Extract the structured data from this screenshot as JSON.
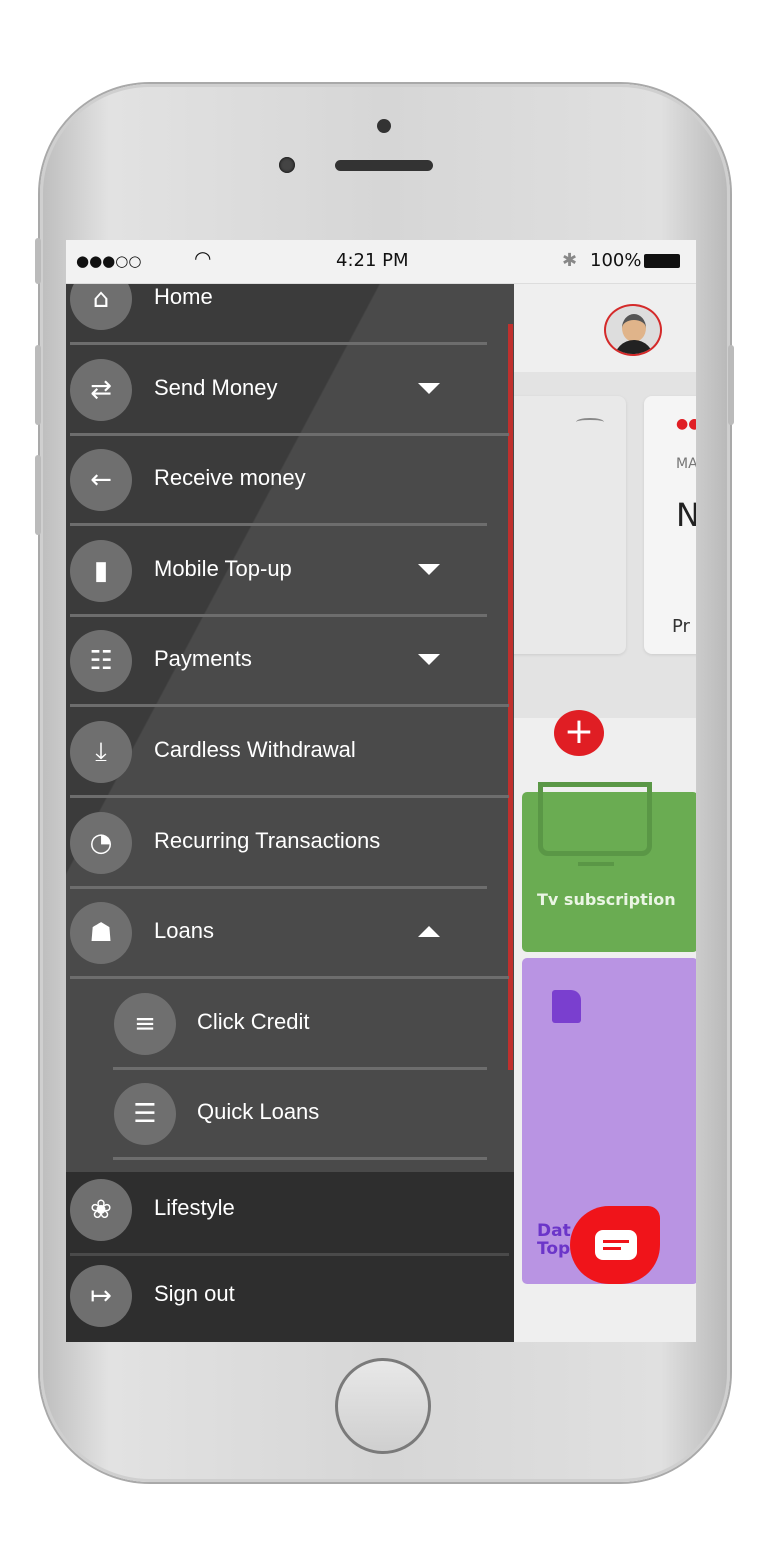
{
  "status_bar": {
    "signal": "●●●○○",
    "wifi_icon": "wifi-icon",
    "time": "4:21 PM",
    "bluetooth_icon": "bluetooth-icon",
    "battery": "100%"
  },
  "menu": {
    "items": [
      {
        "label": "Home",
        "icon": "home-icon"
      },
      {
        "label": "Send Money",
        "icon": "transfer-icon",
        "expand": "down"
      },
      {
        "label": "Receive money",
        "icon": "receive-phone-icon"
      },
      {
        "label": "Mobile Top-up",
        "icon": "sim-card-icon",
        "expand": "down"
      },
      {
        "label": "Payments",
        "icon": "cash-icon",
        "expand": "down"
      },
      {
        "label": "Cardless Withdrawal",
        "icon": "atm-icon"
      },
      {
        "label": "Recurring Transactions",
        "icon": "recurring-coins-icon"
      },
      {
        "label": "Loans",
        "icon": "loan-hand-icon",
        "expand": "up"
      },
      {
        "label": "Click Credit",
        "icon": "money-fly-icon",
        "sub": true
      },
      {
        "label": "Quick Loans",
        "icon": "money-bag-icon",
        "sub": true
      }
    ],
    "bottom_items": [
      {
        "label": "Lifestyle",
        "icon": "lifestyle-tree-icon"
      },
      {
        "label": "Sign out",
        "icon": "sign-out-icon"
      }
    ]
  },
  "background": {
    "card_label": "MA",
    "card_value": "N",
    "card_footer": "Pr",
    "tv_label": "Tv subscription",
    "data_label_line1": "Dat",
    "data_label_line1b": "e",
    "data_label_line2": "Top"
  },
  "colors": {
    "accent": "#e01e24",
    "drawer": "#4a4a4a",
    "tv_tile": "#6aac52",
    "data_tile": "#b994e3"
  }
}
